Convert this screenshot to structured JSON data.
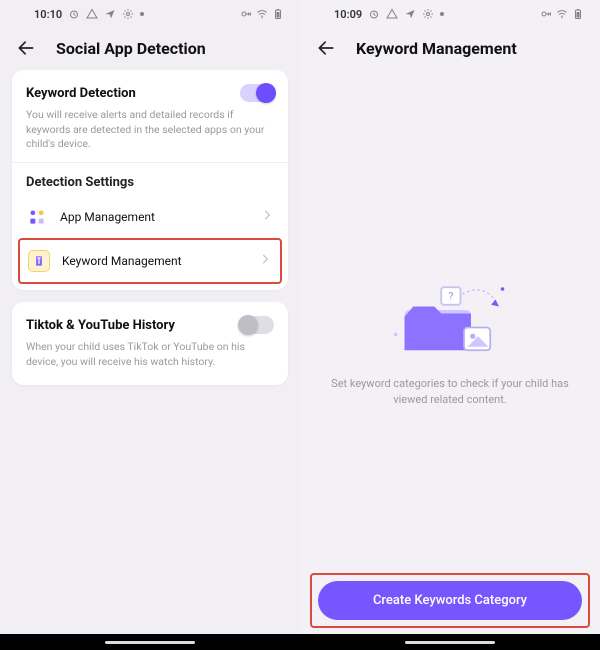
{
  "colors": {
    "accent": "#7856ff",
    "highlight": "#d94b3f"
  },
  "left": {
    "time": "10:10",
    "title": "Social App Detection",
    "keyword_detection": {
      "title": "Keyword Detection",
      "desc": "You will receive alerts and detailed records if keywords are detected in the selected apps on your child's device.",
      "toggle_on": true
    },
    "detection_settings": {
      "title": "Detection Settings",
      "items": [
        {
          "label": "App Management",
          "icon": "grid-apps-icon"
        },
        {
          "label": "Keyword Management",
          "icon": "keyword-icon",
          "highlighted": true
        }
      ]
    },
    "history": {
      "title": "Tiktok & YouTube History",
      "desc": "When your child uses TikTok or YouTube on his device, you will receive his watch history.",
      "toggle_on": false
    }
  },
  "right": {
    "time": "10:09",
    "title": "Keyword Management",
    "empty_text": "Set keyword categories to check if your child has viewed related content.",
    "cta_label": "Create Keywords Category",
    "cta_highlighted": true
  }
}
